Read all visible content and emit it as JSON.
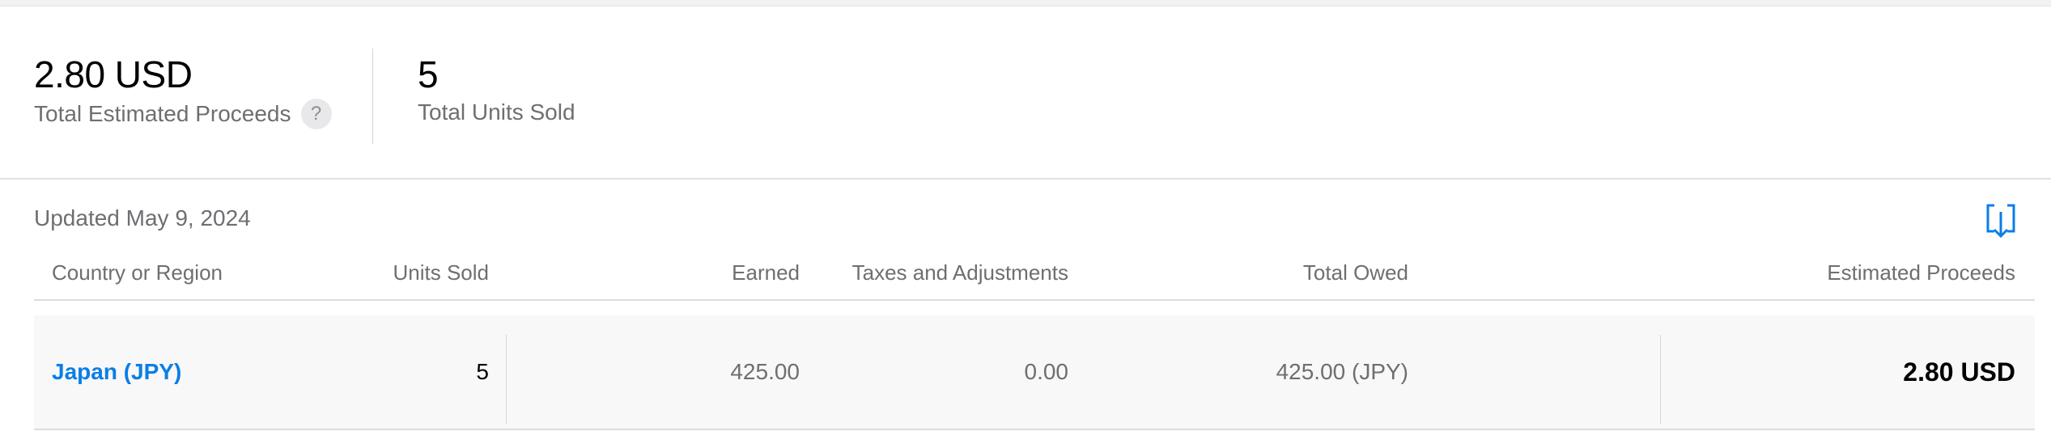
{
  "summary": {
    "proceeds_value": "2.80 USD",
    "proceeds_label": "Total Estimated Proceeds",
    "help_glyph": "?",
    "units_value": "5",
    "units_label": "Total Units Sold"
  },
  "report": {
    "updated_text": "Updated May 9, 2024",
    "download_icon": "download-icon",
    "columns": [
      "Country or Region",
      "Units Sold",
      "Earned",
      "Taxes and Adjustments",
      "Total Owed",
      "Estimated Proceeds"
    ],
    "rows": [
      {
        "country": "Japan (JPY)",
        "units_sold": "5",
        "earned": "425.00",
        "taxes": "0.00",
        "total_owed": "425.00 (JPY)",
        "estimated_proceeds": "2.80 USD"
      }
    ]
  },
  "colors": {
    "link": "#0a7ee6",
    "muted_text": "#6e6e73",
    "row_background": "#f8f8f8"
  }
}
